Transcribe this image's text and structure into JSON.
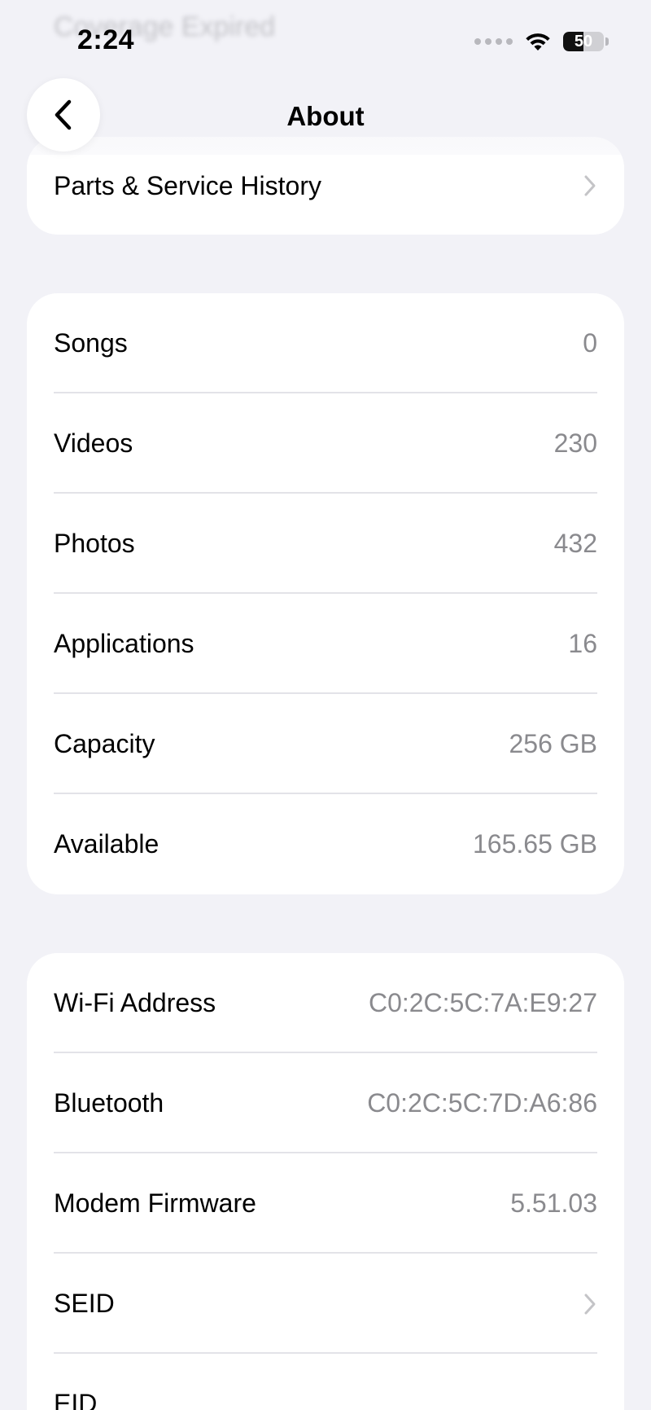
{
  "background_text": "Coverage Expired",
  "status_bar": {
    "time": "2:24",
    "battery_level": "50",
    "battery_fraction": 0.5
  },
  "nav": {
    "title": "About",
    "back_icon": "chevron-left-icon"
  },
  "group_service": {
    "items": [
      {
        "label": "Parts & Service History",
        "chevron": true
      }
    ]
  },
  "group_media": {
    "items": [
      {
        "label": "Songs",
        "value": "0"
      },
      {
        "label": "Videos",
        "value": "230"
      },
      {
        "label": "Photos",
        "value": "432"
      },
      {
        "label": "Applications",
        "value": "16"
      },
      {
        "label": "Capacity",
        "value": "256 GB"
      },
      {
        "label": "Available",
        "value": "165.65 GB"
      }
    ]
  },
  "group_network": {
    "items": [
      {
        "label": "Wi-Fi Address",
        "value": "C0:2C:5C:7A:E9:27"
      },
      {
        "label": "Bluetooth",
        "value": "C0:2C:5C:7D:A6:86"
      },
      {
        "label": "Modem Firmware",
        "value": "5.51.03"
      },
      {
        "label": "SEID",
        "chevron": true
      },
      {
        "label": "EID"
      }
    ]
  },
  "colors": {
    "background": "#f2f2f7",
    "card": "#ffffff",
    "secondary_text": "#8a8a8e",
    "separator": "#e3e3e8"
  }
}
